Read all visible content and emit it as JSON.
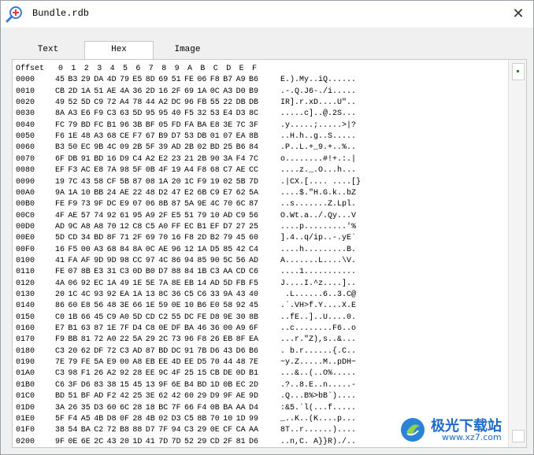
{
  "window": {
    "title": "Bundle.rdb",
    "close_glyph": "✕",
    "app_icon": "search-plus-icon"
  },
  "tabs": [
    {
      "label": "Text",
      "active": false
    },
    {
      "label": "Hex",
      "active": true
    },
    {
      "label": "Image",
      "active": false
    }
  ],
  "hex": {
    "header": {
      "offset": "Offset",
      "cols": [
        "0",
        "1",
        "2",
        "3",
        "4",
        "5",
        "6",
        "7",
        "8",
        "9",
        "A",
        "B",
        "C",
        "D",
        "E",
        "F"
      ]
    },
    "rows": [
      {
        "o": "0000",
        "b": [
          "45",
          "B3",
          "29",
          "DA",
          "4D",
          "79",
          "E5",
          "8D",
          "69",
          "51",
          "FE",
          "06",
          "F8",
          "B7",
          "A9",
          "B6"
        ],
        "a": "E.).My..iQ......"
      },
      {
        "o": "0010",
        "b": [
          "CB",
          "2D",
          "1A",
          "51",
          "AE",
          "4A",
          "36",
          "2D",
          "16",
          "2F",
          "69",
          "1A",
          "0C",
          "A3",
          "D0",
          "B9"
        ],
        "a": ".-.Q.J6-./i....."
      },
      {
        "o": "0020",
        "b": [
          "49",
          "52",
          "5D",
          "C9",
          "72",
          "A4",
          "78",
          "44",
          "A2",
          "DC",
          "96",
          "FB",
          "55",
          "22",
          "DB",
          "DB"
        ],
        "a": "IR].r.xD....U\".."
      },
      {
        "o": "0030",
        "b": [
          "8A",
          "A3",
          "E6",
          "F9",
          "C3",
          "63",
          "5D",
          "95",
          "95",
          "40",
          "F5",
          "32",
          "53",
          "E4",
          "D3",
          "8C"
        ],
        "a": ".....c]..@.2S..."
      },
      {
        "o": "0040",
        "b": [
          "FC",
          "79",
          "BD",
          "FC",
          "B1",
          "96",
          "3B",
          "BF",
          "05",
          "FD",
          "FA",
          "BA",
          "E8",
          "3E",
          "7C",
          "3F"
        ],
        "a": ".y.....;.....>|?"
      },
      {
        "o": "0050",
        "b": [
          "F6",
          "1E",
          "48",
          "A3",
          "68",
          "CE",
          "F7",
          "67",
          "B9",
          "D7",
          "53",
          "DB",
          "01",
          "07",
          "EA",
          "8B"
        ],
        "a": "..H.h..g..S....."
      },
      {
        "o": "0060",
        "b": [
          "B3",
          "50",
          "EC",
          "9B",
          "4C",
          "09",
          "2B",
          "5F",
          "39",
          "AD",
          "2B",
          "02",
          "BD",
          "25",
          "B6",
          "84"
        ],
        "a": ".P..L.+_9.+..%.."
      },
      {
        "o": "0070",
        "b": [
          "6F",
          "DB",
          "91",
          "BD",
          "16",
          "D9",
          "C4",
          "A2",
          "E2",
          "23",
          "21",
          "2B",
          "90",
          "3A",
          "F4",
          "7C"
        ],
        "a": "o........#!+.:.|"
      },
      {
        "o": "0080",
        "b": [
          "EF",
          "F3",
          "AC",
          "E8",
          "7A",
          "98",
          "5F",
          "0B",
          "4F",
          "19",
          "A4",
          "F8",
          "68",
          "C7",
          "AE",
          "CC"
        ],
        "a": "....z._.O...h..."
      },
      {
        "o": "0090",
        "b": [
          "19",
          "7C",
          "43",
          "58",
          "CF",
          "5B",
          "87",
          "08",
          "1A",
          "20",
          "1C",
          "F9",
          "19",
          "02",
          "5B",
          "7D"
        ],
        "a": ".|CX.[.... ....[}"
      },
      {
        "o": "00A0",
        "b": [
          "9A",
          "1A",
          "10",
          "BB",
          "24",
          "AE",
          "22",
          "48",
          "D2",
          "47",
          "E2",
          "6B",
          "C9",
          "E7",
          "62",
          "5A"
        ],
        "a": "....$.\"H.G.k..bZ"
      },
      {
        "o": "00B0",
        "b": [
          "FE",
          "F9",
          "73",
          "9F",
          "DC",
          "E9",
          "07",
          "06",
          "8B",
          "87",
          "5A",
          "9E",
          "4C",
          "70",
          "6C",
          "87"
        ],
        "a": "..s.......Z.Lpl."
      },
      {
        "o": "00C0",
        "b": [
          "4F",
          "AE",
          "57",
          "74",
          "92",
          "61",
          "95",
          "A9",
          "2F",
          "E5",
          "51",
          "79",
          "10",
          "AD",
          "C9",
          "56"
        ],
        "a": "O.Wt.a../.Qy...V"
      },
      {
        "o": "00D0",
        "b": [
          "AD",
          "9C",
          "A8",
          "A8",
          "70",
          "12",
          "C8",
          "C5",
          "A0",
          "FF",
          "EC",
          "B1",
          "EF",
          "D7",
          "27",
          "25"
        ],
        "a": "....p.........'%"
      },
      {
        "o": "00E0",
        "b": [
          "5D",
          "CD",
          "34",
          "BD",
          "8F",
          "71",
          "2F",
          "69",
          "70",
          "16",
          "F8",
          "2D",
          "B2",
          "79",
          "45",
          "60"
        ],
        "a": "].4..q/ip..-.yE`"
      },
      {
        "o": "00F0",
        "b": [
          "16",
          "F5",
          "00",
          "A3",
          "68",
          "84",
          "8A",
          "0C",
          "AE",
          "96",
          "12",
          "1A",
          "D5",
          "85",
          "42",
          "C4"
        ],
        "a": "....h.........B."
      },
      {
        "o": "0100",
        "b": [
          "41",
          "FA",
          "AF",
          "9D",
          "9D",
          "98",
          "CC",
          "97",
          "4C",
          "86",
          "94",
          "85",
          "90",
          "5C",
          "56",
          "AD"
        ],
        "a": "A.......L....\\V."
      },
      {
        "o": "0110",
        "b": [
          "FE",
          "07",
          "8B",
          "E3",
          "31",
          "C3",
          "0D",
          "B0",
          "D7",
          "88",
          "84",
          "1B",
          "C3",
          "AA",
          "CD",
          "C6"
        ],
        "a": "....1..........."
      },
      {
        "o": "0120",
        "b": [
          "4A",
          "06",
          "92",
          "EC",
          "1A",
          "49",
          "1E",
          "5E",
          "7A",
          "8E",
          "EB",
          "14",
          "AD",
          "5D",
          "FB",
          "F5"
        ],
        "a": "J....I.^z....].."
      },
      {
        "o": "0130",
        "b": [
          "20",
          "1C",
          "4C",
          "93",
          "92",
          "EA",
          "1A",
          "13",
          "8C",
          "36",
          "C5",
          "C6",
          "33",
          "9A",
          "43",
          "40"
        ],
        "a": " .L......6..3.C@"
      },
      {
        "o": "0140",
        "b": [
          "86",
          "60",
          "E8",
          "56",
          "48",
          "3E",
          "66",
          "1E",
          "59",
          "0E",
          "10",
          "B6",
          "E0",
          "58",
          "92",
          "45"
        ],
        "a": ".`.VH>f.Y....X.E"
      },
      {
        "o": "0150",
        "b": [
          "C0",
          "1B",
          "66",
          "45",
          "C9",
          "A0",
          "5D",
          "CD",
          "C2",
          "55",
          "DC",
          "FE",
          "D8",
          "9E",
          "30",
          "8B"
        ],
        "a": "..fE..]..U....0."
      },
      {
        "o": "0160",
        "b": [
          "E7",
          "B1",
          "63",
          "87",
          "1E",
          "7F",
          "D4",
          "C8",
          "0E",
          "DF",
          "BA",
          "46",
          "36",
          "00",
          "A9",
          "6F"
        ],
        "a": "..c........F6..o"
      },
      {
        "o": "0170",
        "b": [
          "F9",
          "BB",
          "81",
          "72",
          "A0",
          "22",
          "5A",
          "29",
          "2C",
          "73",
          "96",
          "F8",
          "26",
          "EB",
          "8F",
          "EA"
        ],
        "a": "...r.\"Z),s..&..."
      },
      {
        "o": "0180",
        "b": [
          "C3",
          "20",
          "62",
          "DF",
          "72",
          "C3",
          "AD",
          "87",
          "BD",
          "DC",
          "91",
          "7B",
          "D6",
          "43",
          "D6",
          "B6"
        ],
        "a": ". b.r......{.C.."
      },
      {
        "o": "0190",
        "b": [
          "7E",
          "79",
          "FE",
          "5A",
          "E9",
          "00",
          "A8",
          "EB",
          "EE",
          "4D",
          "EE",
          "D5",
          "70",
          "44",
          "48",
          "7E"
        ],
        "a": "~y.Z.....M..pDH~"
      },
      {
        "o": "01A0",
        "b": [
          "C3",
          "98",
          "F1",
          "26",
          "A2",
          "92",
          "28",
          "EE",
          "9C",
          "4F",
          "25",
          "15",
          "CB",
          "DE",
          "0D",
          "B1"
        ],
        "a": "...&..(..O%....."
      },
      {
        "o": "01B0",
        "b": [
          "C6",
          "3F",
          "D6",
          "83",
          "38",
          "15",
          "45",
          "13",
          "9F",
          "6E",
          "B4",
          "BD",
          "1D",
          "0B",
          "EC",
          "2D"
        ],
        "a": ".?..8.E..n.....-"
      },
      {
        "o": "01C0",
        "b": [
          "BD",
          "51",
          "BF",
          "AD",
          "F2",
          "42",
          "25",
          "3E",
          "62",
          "42",
          "60",
          "29",
          "D9",
          "9F",
          "AE",
          "9D"
        ],
        "a": ".Q...B%>bB`)...."
      },
      {
        "o": "01D0",
        "b": [
          "3A",
          "26",
          "35",
          "D3",
          "60",
          "6C",
          "28",
          "18",
          "BC",
          "7F",
          "66",
          "F4",
          "0B",
          "BA",
          "AA",
          "D4"
        ],
        "a": ":&5.`l(...f....."
      },
      {
        "o": "01E0",
        "b": [
          "5F",
          "F4",
          "A5",
          "4B",
          "D8",
          "0F",
          "28",
          "4B",
          "02",
          "D3",
          "C5",
          "8B",
          "70",
          "10",
          "1D",
          "99"
        ],
        "a": "_..K..(K....p..."
      },
      {
        "o": "01F0",
        "b": [
          "38",
          "54",
          "BA",
          "C2",
          "72",
          "B8",
          "88",
          "D7",
          "7F",
          "94",
          "C3",
          "29",
          "0E",
          "CF",
          "CA",
          "AA"
        ],
        "a": "8T..r......)...."
      },
      {
        "o": "0200",
        "b": [
          "9F",
          "0E",
          "6E",
          "2C",
          "43",
          "20",
          "1D",
          "41",
          "7D",
          "7D",
          "52",
          "29",
          "CD",
          "2F",
          "81",
          "D6"
        ],
        "a": "..n,C. A}}R)./.."
      }
    ]
  },
  "watermark": {
    "title": "极光下载站",
    "url": "www.xz7.com"
  }
}
